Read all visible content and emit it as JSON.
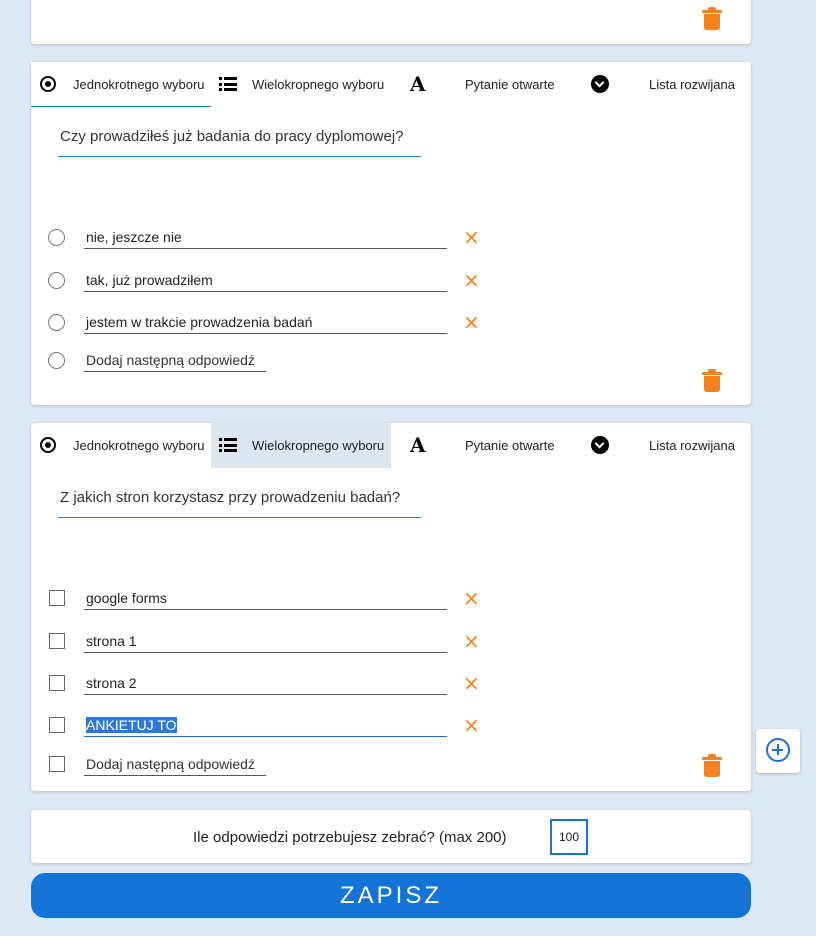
{
  "tabs": {
    "single": "Jednokrotnego wyboru",
    "multi": "Wielokropnego wyboru",
    "open": "Pytanie otwarte",
    "dropdown": "Lista rozwijana"
  },
  "questions": [
    {
      "type_active": "single",
      "text": "Czy prowadziłeś już badania do pracy dyplomowej?",
      "answers": [
        "nie, jeszcze nie",
        "tak, już prowadziłem",
        "jestem w trakcie prowadzenia badań"
      ],
      "add_answer": "Dodaj następną odpowiedź"
    },
    {
      "type_active": "multi",
      "text": "Z jakich stron korzystasz przy prowadzeniu badań?",
      "answers": [
        "google forms",
        "strona 1",
        "strona 2",
        "ANKIETUJ TO"
      ],
      "add_answer": "Dodaj następną odpowiedź"
    }
  ],
  "delete_symbol": "×",
  "responses": {
    "label": "Ile odpowiedzi potrzebujesz zebrać? (max 200)",
    "value": "100"
  },
  "save_label": "ZAPISZ",
  "colors": {
    "background": "#dde8f5",
    "accent": "#1473d6",
    "delete": "#f5821f",
    "active_tab": "#dce6f1"
  }
}
